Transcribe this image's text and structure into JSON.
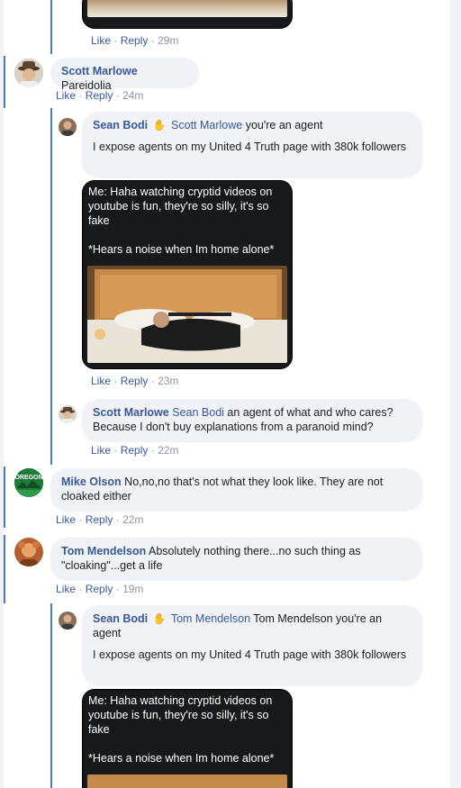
{
  "top_comment": {
    "like": "Like",
    "reply": "Reply",
    "time": "29m"
  },
  "comments": [
    {
      "author": "Scott Marlowe",
      "text": "Pareidolia",
      "like": "Like",
      "reply": "Reply",
      "time": "24m",
      "avatar_icon": "man-with-hat-avatar"
    },
    {
      "author": "Sean Bodi",
      "mention": "Scott Marlowe",
      "text": " you're an agent",
      "text2": "I expose agents on my United 4 Truth page with 380k followers",
      "like": "Like",
      "reply": "Reply",
      "time": "23m",
      "avatar_icon": "person-avatar"
    },
    {
      "author": "Scott Marlowe",
      "mention": "Sean Bodi",
      "text": " an agent of what and who cares? Because I don't buy explanations from a paranoid mind?",
      "like": "Like",
      "reply": "Reply",
      "time": "22m"
    },
    {
      "author": "Mike Olson",
      "text": " No,no,no that's not what they look like. They are not cloaked either",
      "like": "Like",
      "reply": "Reply",
      "time": "22m",
      "avatar_text": "OREGON",
      "avatar_color": "#1f7a3a"
    },
    {
      "author": "Tom Mendelson",
      "text": " Absolutely nothing there...no such thing as \"cloaking\"...get a life",
      "like": "Like",
      "reply": "Reply",
      "time": "19m"
    },
    {
      "author": "Sean Bodi",
      "mention": "Tom Mendelson",
      "text": " Tom Mendelson you're an agent",
      "text2": "I expose agents on my United 4 Truth page with 380k followers"
    }
  ],
  "meme": {
    "line1": "Me: Haha watching cryptid videos on youtube is fun, they're so silly, it's so fake",
    "line2": "*Hears a noise when Im home alone*"
  },
  "separator": "·",
  "colors": {
    "link": "#385898",
    "thread_line": "#4a76c4",
    "bubble": "#f0f2f5",
    "meme_bg": "#18191a"
  }
}
